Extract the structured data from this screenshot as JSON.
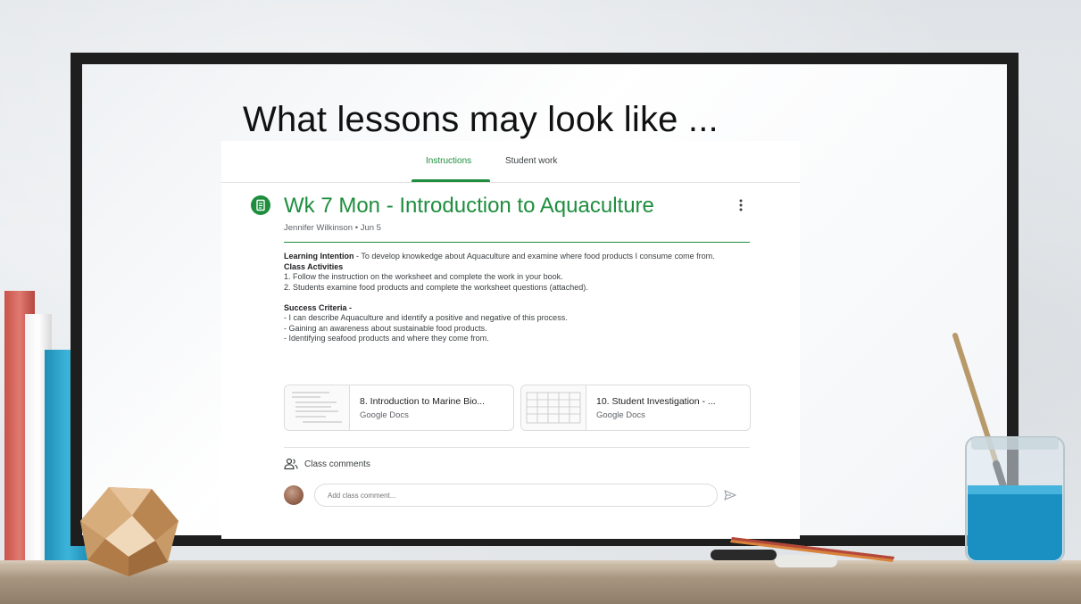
{
  "slide": {
    "title": "What lessons may look like ..."
  },
  "tabs": [
    {
      "label": "Instructions",
      "active": true
    },
    {
      "label": "Student work",
      "active": false
    }
  ],
  "assignment": {
    "title": "Wk 7 Mon - Introduction to Aquaculture",
    "meta": "Jennifer Wilkinson • Jun 5",
    "learning_intention_label": "Learning Intention",
    "learning_intention_text": " - To develop knowkedge about Aquaculture and examine where food products I consume come from.",
    "class_activities_label": "Class Activities",
    "activities": [
      "1. Follow the instruction on the worksheet and complete the work in your book.",
      "2. Students examine food products and complete the worksheet questions (attached)."
    ],
    "success_criteria_label": "Success Criteria -",
    "success_criteria": [
      "- I can describe Aquaculture and identify a positive and negative of this process.",
      "- Gaining an awareness about sustainable food products.",
      "- Identifying seafood products and where they come from."
    ]
  },
  "attachments": [
    {
      "title": "8. Introduction to Marine Bio...",
      "type": "Google Docs"
    },
    {
      "title": "10. Student Investigation - ...",
      "type": "Google Docs"
    }
  ],
  "comments": {
    "label": "Class comments",
    "placeholder": "Add class comment..."
  },
  "icons": {
    "assignment": "assignment-icon",
    "more": "more-vert-icon",
    "people": "people-icon",
    "send": "send-icon"
  },
  "colors": {
    "accent": "#1e8e3e",
    "text": "#3c4043",
    "muted": "#5f6368"
  }
}
